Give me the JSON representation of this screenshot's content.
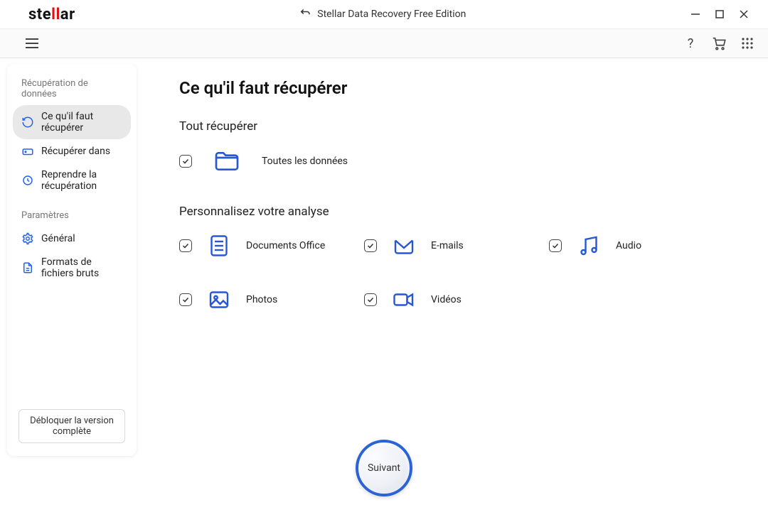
{
  "window": {
    "title": "Stellar Data Recovery Free Edition"
  },
  "brand": {
    "pre": "ste",
    "mid": "ll",
    "post": "ar"
  },
  "sidebar": {
    "sections": {
      "recovery_label": "Récupération de données",
      "settings_label": "Paramètres"
    },
    "items": {
      "what_to_recover": "Ce qu'il faut récupérer",
      "recover_from": "Récupérer dans",
      "resume_recovery": "Reprendre la récupération",
      "general": "Général",
      "raw_formats": "Formats de fichiers bruts"
    },
    "unlock": "Débloquer la version complète"
  },
  "main": {
    "title": "Ce qu'il faut récupérer",
    "recover_all_label": "Tout récupérer",
    "all_data_label": "Toutes les données",
    "customize_label": "Personnalisez votre analyse",
    "categories": {
      "documents": "Documents Office",
      "emails": "E-mails",
      "audio": "Audio",
      "photos": "Photos",
      "videos": "Vidéos"
    },
    "next": "Suivant"
  }
}
